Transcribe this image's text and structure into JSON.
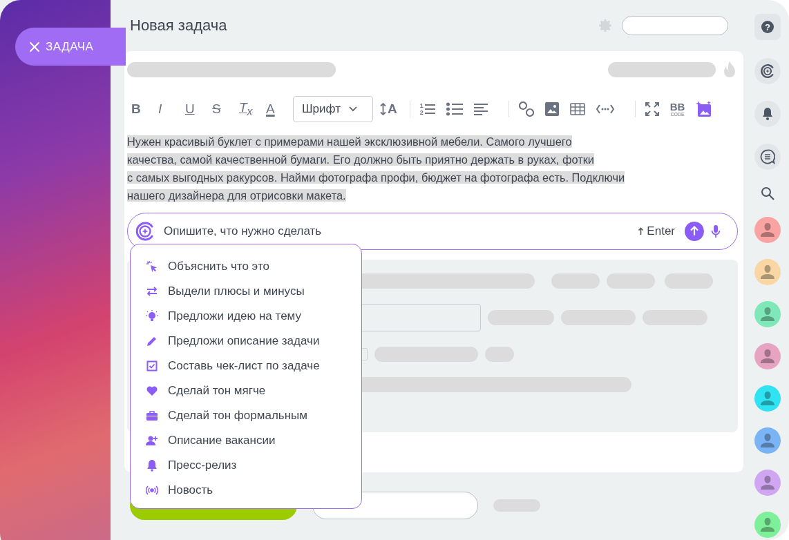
{
  "side_button": {
    "label": "ЗАДАЧА"
  },
  "header": {
    "title": "Новая задача"
  },
  "toolbar": [
    {
      "kind": "bold",
      "label": "B"
    },
    {
      "kind": "italic",
      "label": "I"
    },
    {
      "kind": "underline",
      "label": "U"
    },
    {
      "kind": "strike",
      "label": "S"
    },
    {
      "kind": "clear",
      "label": "T$_{x}$"
    },
    {
      "kind": "color",
      "label": "A"
    },
    {
      "kind": "font",
      "label": "Шрифт"
    },
    {
      "kind": "size",
      "label": "A"
    },
    {
      "kind": "sep"
    },
    {
      "kind": "ordered-list",
      "digits": [
        "1",
        "2"
      ]
    },
    {
      "kind": "bullet-list"
    },
    {
      "kind": "align"
    },
    {
      "kind": "sep"
    },
    {
      "kind": "link"
    },
    {
      "kind": "image"
    },
    {
      "kind": "table"
    },
    {
      "kind": "code"
    },
    {
      "kind": "sep"
    },
    {
      "kind": "fullscreen"
    },
    {
      "kind": "bbcode",
      "label": "BB",
      "sublabel": "CODE"
    },
    {
      "kind": "ai-image"
    }
  ],
  "description": {
    "text": "Нужен красивый буклет с примерами нашей эксклюзивной мебели. Самого лучшего \nкачества, самой качественной бумаги. Его должно быть приятно держать в руках, фотки \nс самых выгодных ракурсов. Найми фотографа профи, бюджет на фотографа есть. Подключи \nнашего дизайнера для отрисовки макета.",
    "selected": true
  },
  "ai_prompt": {
    "placeholder": "Опишите, что нужно сделать",
    "hint": "Enter"
  },
  "ai_menu": [
    {
      "kind": "cursor",
      "label": "Объяснить что это"
    },
    {
      "kind": "swap",
      "label": "Выдели плюсы и минусы"
    },
    {
      "kind": "bulb",
      "label": "Предложи идею на тему"
    },
    {
      "kind": "pencil",
      "label": "Предложи описание задачи"
    },
    {
      "kind": "checkbox",
      "label": "Составь чек-лист по задаче"
    },
    {
      "kind": "heart",
      "label": "Сделай тон мягче"
    },
    {
      "kind": "briefcase",
      "label": "Сделай тон формальным"
    },
    {
      "kind": "user-plus",
      "label": "Описание вакансии"
    },
    {
      "kind": "bell",
      "label": "Пресс-релиз"
    },
    {
      "kind": "broadcast",
      "label": "Новость"
    }
  ],
  "right_bar": {
    "help": "?",
    "avatars": [
      {
        "color": "#f9a3a3"
      },
      {
        "color": "#f8d7a4"
      },
      {
        "color": "#7ee8b8"
      },
      {
        "color": "#e6a3c2"
      },
      {
        "color": "#2fe3f2"
      },
      {
        "color": "#7ab4f5"
      },
      {
        "color": "#d0a6f2"
      },
      {
        "color": "#7ef09a"
      }
    ]
  }
}
